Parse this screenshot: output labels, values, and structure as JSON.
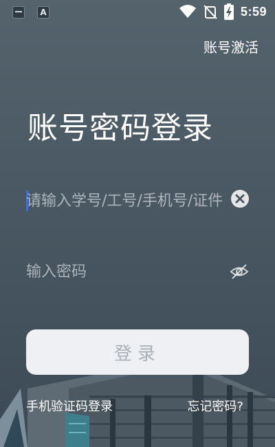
{
  "status_bar": {
    "time": "5:59",
    "left_icons": [
      "app-notification-icon",
      "keyboard-a-icon"
    ],
    "right_icons": [
      "wifi-icon",
      "no-signal-icon",
      "battery-charging-icon"
    ]
  },
  "header": {
    "activate_link": "账号激活"
  },
  "main": {
    "title": "账号密码登录",
    "account_input": {
      "placeholder": "请输入学号/工号/手机号/证件",
      "value": ""
    },
    "password_input": {
      "placeholder": "输入密码",
      "value": ""
    },
    "login_button": "登录"
  },
  "footer": {
    "sms_login": "手机验证码登录",
    "forgot_password": "忘记密码?"
  },
  "colors": {
    "background": "#4b5964",
    "text": "#ffffff",
    "button_bg": "#eef0f3",
    "button_text": "#a9b0b8",
    "caret": "#3b6fe6"
  }
}
